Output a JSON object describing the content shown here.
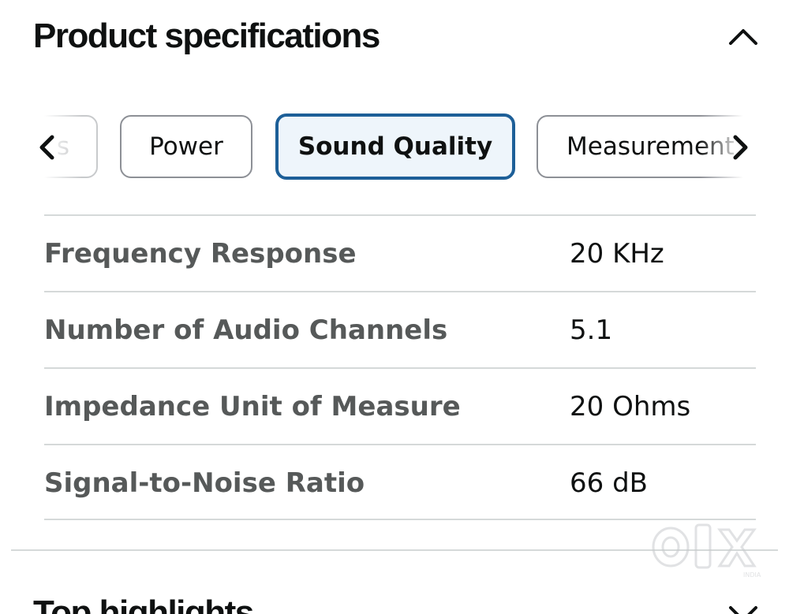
{
  "section": {
    "title": "Product specifications",
    "collapse_icon": "chevron-up-icon"
  },
  "tabs": {
    "items": [
      {
        "label": "s",
        "state": "partially-hidden"
      },
      {
        "label": "Power",
        "state": "default"
      },
      {
        "label": "Sound Quality",
        "state": "selected"
      },
      {
        "label": "Measurement",
        "state": "partially-hidden"
      }
    ],
    "scroll_left_icon": "chevron-left-icon",
    "scroll_right_icon": "chevron-right-icon",
    "active_color": "#1d5f98"
  },
  "specs": [
    {
      "label": "Frequency Response",
      "value": "20 KHz"
    },
    {
      "label": "Number of Audio Channels",
      "value": "5.1"
    },
    {
      "label": "Impedance Unit of Measure",
      "value": "20 Ohms"
    },
    {
      "label": "Signal-to-Noise Ratio",
      "value": "66 dB"
    }
  ],
  "next_section": {
    "title": "Top highlights",
    "expand_icon": "chevron-down-icon"
  },
  "watermark": {
    "brand": "OLX",
    "subtext": "INDIA"
  }
}
